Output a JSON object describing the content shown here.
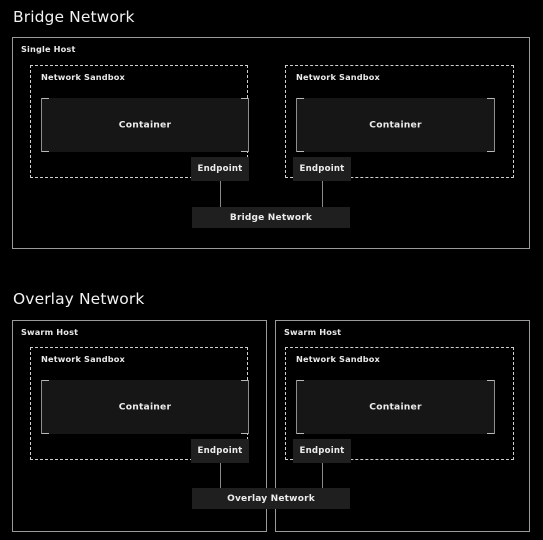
{
  "diagram": {
    "background_color": "#000000",
    "sections": [
      {
        "title": "Bridge Network",
        "hosts": [
          {
            "label": "Single Host",
            "sandboxes": [
              {
                "label": "Network Sandbox",
                "container_label": "Container",
                "endpoint_label": "Endpoint"
              },
              {
                "label": "Network Sandbox",
                "container_label": "Container",
                "endpoint_label": "Endpoint"
              }
            ]
          }
        ],
        "network_bar_label": "Bridge Network"
      },
      {
        "title": "Overlay Network",
        "hosts": [
          {
            "label": "Swarm Host",
            "sandboxes": [
              {
                "label": "Network Sandbox",
                "container_label": "Container",
                "endpoint_label": "Endpoint"
              }
            ]
          },
          {
            "label": "Swarm Host",
            "sandboxes": [
              {
                "label": "Network Sandbox",
                "container_label": "Container",
                "endpoint_label": "Endpoint"
              }
            ]
          }
        ],
        "network_bar_label": "Overlay Network"
      }
    ],
    "colors": {
      "background": "#000000",
      "host_border": "#9a9a9a",
      "sandbox_border": "#cfcfcf",
      "container_fill": "#161616",
      "container_border": "#b9b9b9",
      "chip_fill": "#1f1f1f",
      "connector": "#8a8a8a",
      "text": "#ececec",
      "title_text": "#f2f2f2"
    }
  }
}
